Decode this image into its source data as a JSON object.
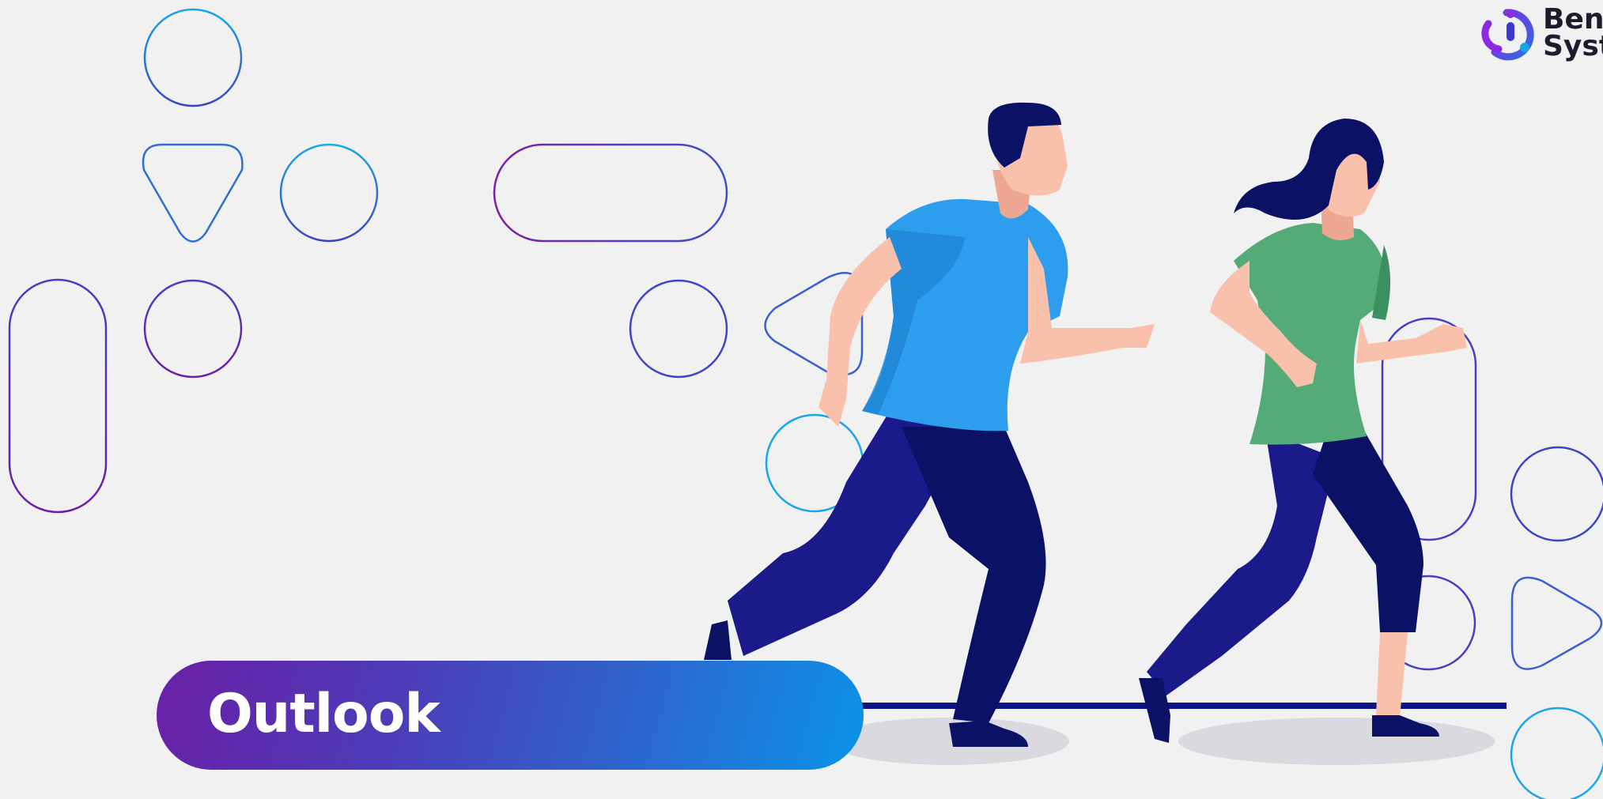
{
  "brand": {
    "name_line1": "Bene",
    "name_line2": "Syste",
    "logo_icon": "benefit-systems-logo-icon"
  },
  "banner": {
    "title": "Outlook"
  },
  "illustration": {
    "subject": "two-people-running-illustration",
    "man_icon": "running-man-icon",
    "woman_icon": "running-woman-icon"
  },
  "colors": {
    "background": "#f1f1f1",
    "banner_start": "#6a1fa6",
    "banner_end": "#0a93e8",
    "shirt_man": "#2d9ded",
    "shirt_woman": "#54ab78",
    "pants": "#1b1a8a",
    "skin": "#f9c1ac",
    "hair": "#0b1266"
  }
}
